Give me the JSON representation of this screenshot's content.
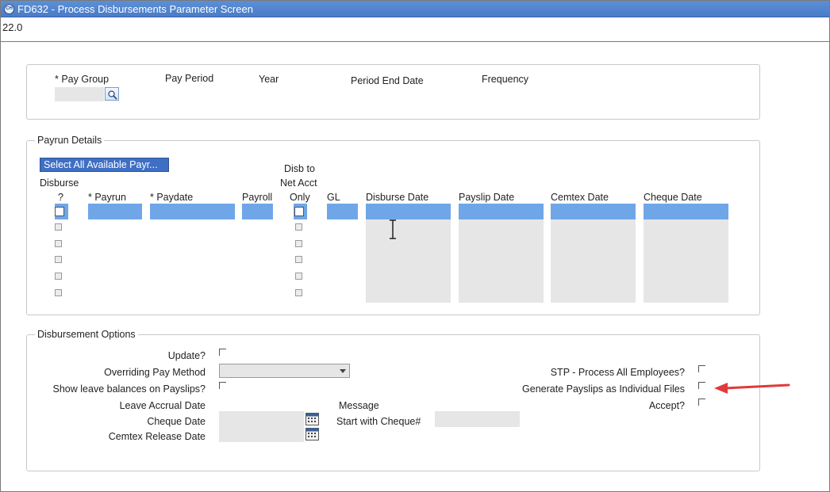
{
  "window": {
    "title": "FD632 - Process Disbursements Parameter Screen",
    "icon": "app-logo-icon",
    "version": "22.0"
  },
  "header_panel": {
    "pay_group_label": "* Pay Group",
    "pay_period_label": "Pay Period",
    "year_label": "Year",
    "period_end_date_label": "Period End Date",
    "frequency_label": "Frequency",
    "lookup_icon": "magnifier-icon"
  },
  "payrun_details": {
    "legend": "Payrun Details",
    "select_all_label": "Select All Available Payr...",
    "columns": {
      "disburse_line1": "Disburse",
      "disburse_line2": "?",
      "payrun": "* Payrun",
      "paydate": "* Paydate",
      "payroll": "Payroll",
      "disb_net_line1": "Disb to",
      "disb_net_line2": "Net Acct",
      "disb_net_line3": "Only",
      "gl": "GL",
      "disburse_date": "Disburse Date",
      "payslip_date": "Payslip Date",
      "cemtex_date": "Cemtex Date",
      "cheque_date": "Cheque Date"
    },
    "row_count": 6
  },
  "disbursement_options": {
    "legend": "Disbursement Options",
    "update_label": "Update?",
    "overriding_pay_method_label": "Overriding Pay Method",
    "overriding_pay_method_value": "",
    "show_leave_label": "Show leave balances on Payslips?",
    "leave_accrual_label": "Leave Accrual Date",
    "cheque_date_label": "Cheque Date",
    "cemtex_release_label": "Cemtex Release Date",
    "message_label": "Message",
    "start_cheque_label": "Start with Cheque#",
    "start_cheque_value": "",
    "stp_label": "STP - Process All Employees?",
    "generate_payslips_label": "Generate Payslips as Individual Files",
    "accept_label": "Accept?",
    "calendar_icon": "calendar-icon"
  },
  "annotation": {
    "arrow_color": "#e03a3a"
  }
}
